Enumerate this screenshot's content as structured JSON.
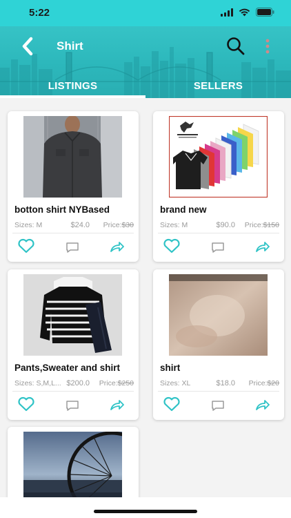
{
  "status_bar": {
    "time": "5:22"
  },
  "header": {
    "title": "Shirt"
  },
  "tabs": [
    {
      "label": "LISTINGS"
    },
    {
      "label": "SELLERS"
    }
  ],
  "listings": [
    {
      "title": "botton shirt NYBased",
      "sizes": "Sizes: M",
      "price": "$24.0",
      "orig_label": "Price:",
      "orig_value": "$30"
    },
    {
      "title": "brand new",
      "sizes": "Sizes: M",
      "price": "$90.0",
      "orig_label": "Price:",
      "orig_value": "$150"
    },
    {
      "title": "Pants,Sweater and  shirt",
      "sizes": "Sizes: S,M,L...",
      "price": "$200.0",
      "orig_label": "Price:",
      "orig_value": "$250"
    },
    {
      "title": "shirt",
      "sizes": "Sizes: XL",
      "price": "$18.0",
      "orig_label": "Price:",
      "orig_value": "$20"
    }
  ],
  "colors": {
    "accent": "#2fd3d6",
    "header": "#2cb7bb",
    "action_icon": "#2fc3c6"
  },
  "icons": [
    "back-arrow-icon",
    "search-icon",
    "more-vertical-icon",
    "heart-icon",
    "comment-icon",
    "share-icon",
    "wifi-icon",
    "battery-icon",
    "signal-icon"
  ]
}
